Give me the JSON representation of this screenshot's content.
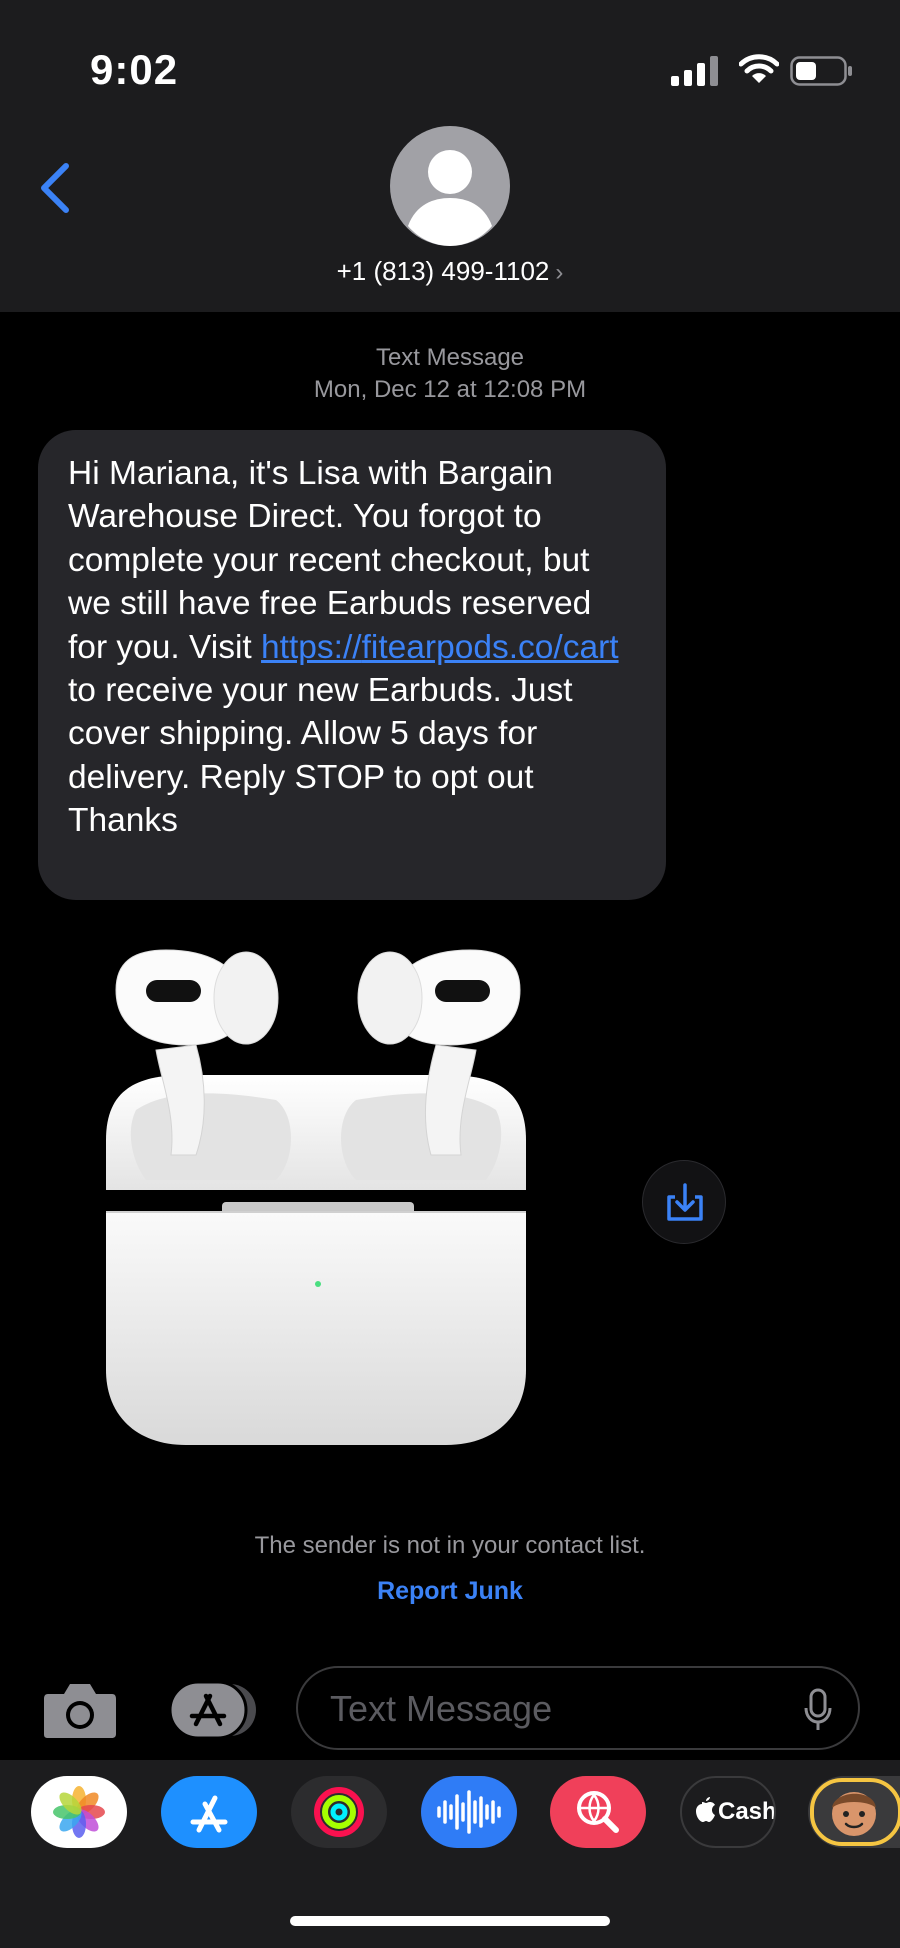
{
  "status_bar": {
    "time": "9:02"
  },
  "header": {
    "contact": "+1 (813) 499-1102",
    "chevron": "›"
  },
  "message_meta": {
    "kind": "Text Message",
    "datetime": "Mon, Dec 12 at 12:08 PM"
  },
  "message": {
    "text_before_link": "Hi Mariana, it's Lisa with Bargain Warehouse Direct. You forgot to complete your recent checkout, but we still have free Earbuds reserved for you. Visit ",
    "link_line1": "https://",
    "link_line2": "fitearpods.co/cart",
    "text_after_link": " to receive your new Earbuds. Just cover shipping. Allow 5 days for delivery. Reply STOP to opt out Thanks"
  },
  "attachment": {
    "icon": "earbuds-photo"
  },
  "junk_notice": {
    "text": "The sender is not in your contact list.",
    "report_label": "Report Junk"
  },
  "compose": {
    "placeholder": "Text Message"
  },
  "app_drawer": {
    "apps": [
      "Photos",
      "App Store",
      "Fitness",
      "Audio Messages",
      "Search Images",
      "Apple Cash",
      "Memoji"
    ],
    "cash_label": "Cash"
  },
  "colors": {
    "accent": "#3b82f6",
    "bubble": "#26262a",
    "header": "#1c1c1e"
  }
}
